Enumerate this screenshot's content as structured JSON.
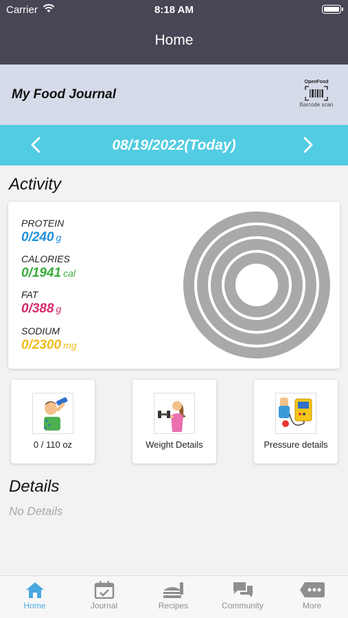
{
  "status": {
    "carrier": "Carrier",
    "time": "8:18 AM"
  },
  "nav": {
    "title": "Home"
  },
  "journal": {
    "title": "My Food Journal",
    "barcode_top": "OpenFood",
    "barcode_bottom": "Barcode scan"
  },
  "date": {
    "label": "08/19/2022(Today)"
  },
  "activity": {
    "title": "Activity",
    "nutrients": [
      {
        "label": "PROTEIN",
        "value": "0/240",
        "unit": "g",
        "color": "#1f8fd8"
      },
      {
        "label": "CALORIES",
        "value": "0/1941",
        "unit": "cal",
        "color": "#3cab3c"
      },
      {
        "label": "FAT",
        "value": "0/388",
        "unit": "g",
        "color": "#d42a6a"
      },
      {
        "label": "SODIUM",
        "value": "0/2300",
        "unit": "mg",
        "color": "#f0bb1c"
      }
    ],
    "rings_color": "#a9a9a9"
  },
  "tiles": [
    {
      "caption": "0 / 110 oz",
      "icon": "water-drinker-icon"
    },
    {
      "caption": "Weight Details",
      "icon": "weight-lifter-icon"
    },
    {
      "caption": "Pressure details",
      "icon": "blood-pressure-monitor-icon"
    }
  ],
  "details": {
    "title": "Details",
    "empty": "No Details"
  },
  "tabs": [
    {
      "label": "Home",
      "icon": "home-icon",
      "active": true
    },
    {
      "label": "Journal",
      "icon": "calendar-check-icon",
      "active": false
    },
    {
      "label": "Recipes",
      "icon": "recipes-icon",
      "active": false
    },
    {
      "label": "Community",
      "icon": "chat-bubbles-icon",
      "active": false
    },
    {
      "label": "More",
      "icon": "more-icon",
      "active": false
    }
  ],
  "colors": {
    "topbar": "#474655",
    "date_bar": "#52cce2",
    "journal_bar": "#d5dbe9",
    "tab_active": "#4aa8e0",
    "tab_inactive": "#8e8e8e"
  }
}
